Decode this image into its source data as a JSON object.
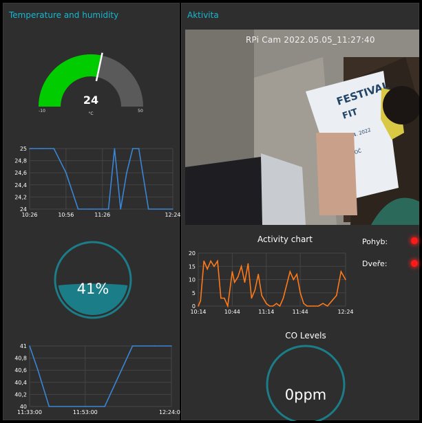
{
  "left_panel": {
    "title": "Temperature and humidity",
    "gauge": {
      "value": "24",
      "unit": "°C",
      "min": "-10",
      "max": "50",
      "value_num": 24,
      "min_num": -10,
      "max_num": 50,
      "color_fill": "#00cc00",
      "color_rest": "#5a5a5a"
    },
    "temp_chart": {
      "y_ticks": [
        "25",
        "24,8",
        "24,6",
        "24,4",
        "24,2",
        "24"
      ],
      "x_ticks": [
        "10:26",
        "10:56",
        "11:26",
        "12:24"
      ]
    },
    "humidity": {
      "value": "41%",
      "fraction": 0.41,
      "color": "#1a7d88"
    },
    "humidity_chart": {
      "y_ticks": [
        "41",
        "40,8",
        "40,6",
        "40,4",
        "40,2",
        "40"
      ],
      "x_ticks": [
        "11:33:00",
        "11:53:00",
        "12:24:00"
      ]
    }
  },
  "right_panel": {
    "title": "Aktivita",
    "camera": {
      "overlay": "RPi Cam 2022.05.05_11:27:40"
    },
    "activity_chart": {
      "title": "Activity chart",
      "y_ticks": [
        "20",
        "15",
        "10",
        "5",
        "0"
      ],
      "x_ticks": [
        "10:14",
        "10:44",
        "11:14",
        "11:44",
        "12:24"
      ]
    },
    "indicators": [
      {
        "label": "Pohyb:",
        "color": "#ff1a1a"
      },
      {
        "label": "Dveře:",
        "color": "#ff1a1a"
      }
    ],
    "co": {
      "title": "CO Levels",
      "value": "0ppm"
    }
  },
  "chart_data": [
    {
      "type": "line",
      "name": "temperature",
      "x": [
        "10:26",
        "10:36",
        "10:46",
        "10:56",
        "11:06",
        "11:16",
        "11:26",
        "11:31",
        "11:36",
        "11:41",
        "11:46",
        "11:51",
        "11:56",
        "12:04",
        "12:14",
        "12:24"
      ],
      "y": [
        25,
        25,
        25,
        24.6,
        24,
        24,
        24,
        24,
        25,
        24,
        24.6,
        25,
        25,
        24,
        24,
        24
      ],
      "ylim": [
        24,
        25
      ],
      "color": "#3a86d6"
    },
    {
      "type": "line",
      "name": "humidity",
      "x": [
        "11:33:00",
        "11:36:00",
        "11:40:00",
        "11:53:00",
        "12:00:00",
        "12:10:00",
        "12:18:00",
        "12:24:00"
      ],
      "y": [
        41,
        40.6,
        40,
        40,
        40,
        41,
        41,
        41
      ],
      "ylim": [
        40,
        41
      ],
      "color": "#3a86d6"
    },
    {
      "type": "line",
      "title": "Activity chart",
      "x": [
        "10:14",
        "10:16",
        "10:19",
        "10:22",
        "10:25",
        "10:28",
        "10:31",
        "10:34",
        "10:37",
        "10:40",
        "10:44",
        "10:46",
        "10:49",
        "10:52",
        "10:55",
        "10:58",
        "11:01",
        "11:04",
        "11:07",
        "11:10",
        "11:14",
        "11:17",
        "11:20",
        "11:23",
        "11:26",
        "11:29",
        "11:32",
        "11:35",
        "11:38",
        "11:41",
        "11:44",
        "11:47",
        "11:50",
        "11:53",
        "11:56",
        "12:00",
        "12:04",
        "12:08",
        "12:12",
        "12:16",
        "12:20",
        "12:24"
      ],
      "y": [
        0,
        2,
        17,
        14,
        17,
        15,
        17,
        3,
        3,
        0,
        13,
        9,
        11,
        15,
        9,
        16,
        3,
        6,
        12,
        4,
        1,
        0,
        0,
        1,
        0,
        3,
        8,
        13,
        10,
        12,
        5,
        1,
        0,
        0,
        0,
        0,
        1,
        0,
        2,
        4,
        13,
        10
      ],
      "ylim": [
        0,
        20
      ],
      "color": "#ff7a1a"
    }
  ]
}
